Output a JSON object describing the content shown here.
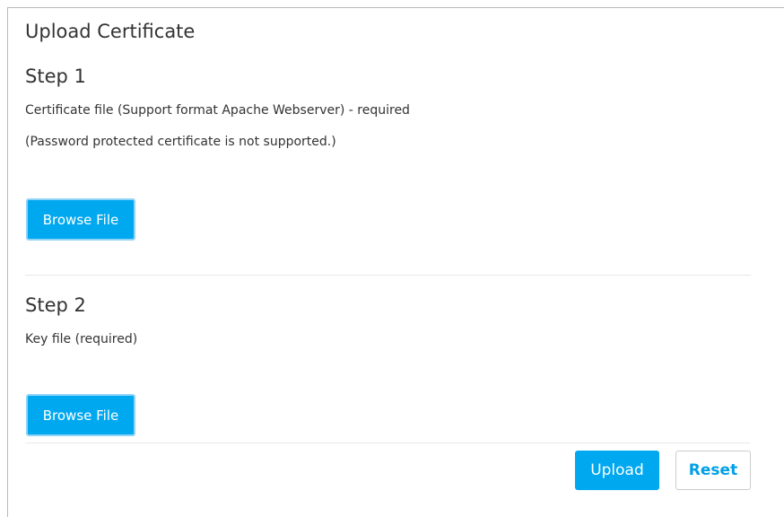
{
  "panel": {
    "title": "Upload Certificate"
  },
  "step1": {
    "heading": "Step 1",
    "description": "Certificate file (Support format Apache Webserver) - required",
    "note": "(Password protected certificate is not supported.)",
    "browse_label": "Browse File"
  },
  "step2": {
    "heading": "Step 2",
    "description": "Key file (required)",
    "browse_label": "Browse File"
  },
  "actions": {
    "upload_label": "Upload",
    "reset_label": "Reset"
  },
  "colors": {
    "primary": "#00a8f0",
    "reset_text": "#00a0e6"
  }
}
